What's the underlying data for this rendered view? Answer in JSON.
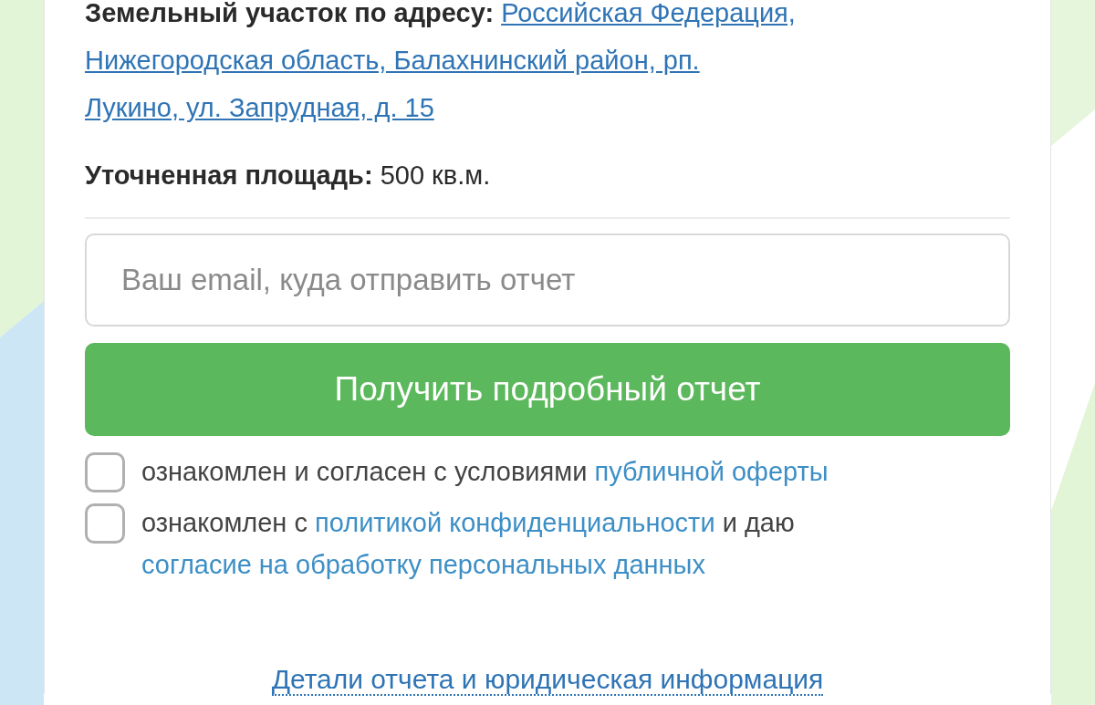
{
  "address": {
    "label": "Земельный участок по адресу:",
    "link_lines": [
      "Российская Федерация,",
      "Нижегородская область, Балахнинский район, рп.",
      "Лукино, ул. Запрудная, д. 15"
    ]
  },
  "area": {
    "label": "Уточненная площадь:",
    "value": "500 кв.м."
  },
  "email": {
    "placeholder": "Ваш email, куда отправить отчет"
  },
  "submit": {
    "label": "Получить подробный отчет"
  },
  "agreements": [
    {
      "checked": false,
      "parts": [
        {
          "text": "ознакомлен и согласен с условиями",
          "link": false
        },
        {
          "text": "публичной оферты",
          "link": true
        }
      ]
    },
    {
      "checked": false,
      "parts": [
        {
          "text": "ознакомлен с",
          "link": false
        },
        {
          "text": "политикой конфиденциальности",
          "link": true
        },
        {
          "text": "и даю",
          "link": false
        },
        {
          "text": "согласие на обработку персональных данных",
          "link": true
        }
      ]
    }
  ],
  "footer_link": "Детали отчета и юридическая информация"
}
